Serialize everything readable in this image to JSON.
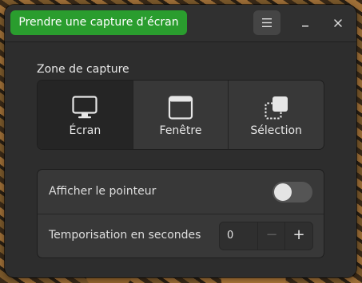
{
  "header": {
    "capture_label": "Prendre une capture d’écran",
    "menu_icon": "hamburger-menu-icon",
    "minimize_icon": "minimize-icon",
    "close_icon": "close-icon"
  },
  "capture_area": {
    "title": "Zone de capture",
    "options": [
      {
        "label": "Écran",
        "icon": "monitor-icon",
        "selected": true
      },
      {
        "label": "Fenêtre",
        "icon": "window-icon",
        "selected": false
      },
      {
        "label": "Sélection",
        "icon": "selection-icon",
        "selected": false
      }
    ]
  },
  "settings": {
    "show_pointer": {
      "label": "Afficher le pointeur",
      "enabled": false
    },
    "delay": {
      "label": "Temporisation en secondes",
      "value": "0",
      "minus": "−",
      "plus": "+"
    }
  },
  "colors": {
    "accent_green": "#2a9d2e",
    "window_bg": "#2d2d2d",
    "card_bg": "#383838"
  }
}
